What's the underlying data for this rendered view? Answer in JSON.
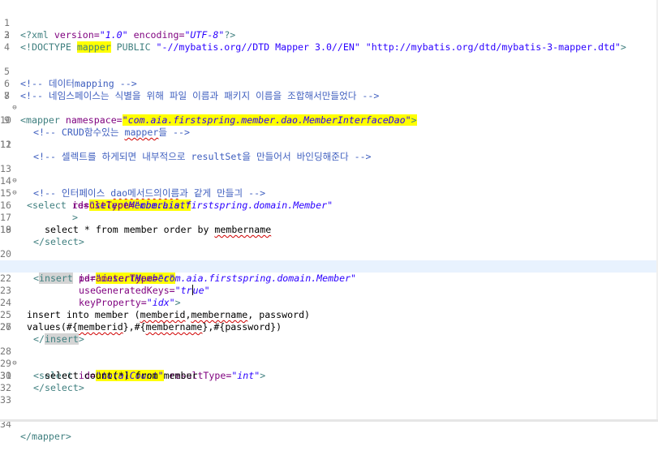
{
  "editor": {
    "lines": {
      "l1": {
        "n": "1",
        "a": "<?xml",
        "b": " version=",
        "c": "\"1.0\"",
        "d": " encoding=",
        "e": "\"UTF-8\"",
        "f": "?>"
      },
      "l2": {
        "n": "2",
        "a": "<!DOCTYPE ",
        "b": "mapper",
        "c": " PUBLIC ",
        "d": "\"-//mybatis.org//DTD Mapper 3.0//EN\" \"http://mybatis.org/dtd/mybatis-3-mapper.dtd\"",
        "e": ">"
      },
      "l3": {
        "n": "3"
      },
      "l4": {
        "n": "4"
      },
      "l5": {
        "n": "5",
        "a": "<!-- 데이터mapping -->"
      },
      "l6": {
        "n": "6",
        "a": "<!-- 네임스페이스는 식별을 위해 파일 이름과 패키지 이름을 조합해서만들었다 -->"
      },
      "l7": {
        "n": "7",
        "a": "<mapper",
        "b": " namespace=",
        "c": "\"com.aia.firstspring.member.dao.MemberInterfaceDao\"",
        "d": ">"
      },
      "l8": {
        "n": "8"
      },
      "l9": {
        "n": "9",
        "a": "<!-- CRUD함수있는 ",
        "b": "mapper",
        "c": "들 -->"
      },
      "l10": {
        "n": "10"
      },
      "l11": {
        "n": "11",
        "a": "<!-- 셀렉트를 하게되면 내부적으로 resultSet을 만들어서 바인딩해준다 -->"
      },
      "l12": {
        "n": "12"
      },
      "l13": {
        "n": "13",
        "a": "<!-- 인터페이스 ",
        "b": "dao메서드의이름",
        "c": "과 같게 만들긔 -->"
      },
      "l14": {
        "n": "14",
        "a": "<select",
        "b": " id=",
        "c": "\"selectMemberList\""
      },
      "l15": {
        "n": "15",
        "a": "resultType=",
        "b": "\"com.aia.firstspring.domain.Member\""
      },
      "l16": {
        "n": "16",
        "a": ">"
      },
      "l17": {
        "n": "17",
        "a": "select * from member order by ",
        "b": "membername"
      },
      "l18": {
        "n": "18",
        "a": "</select>"
      },
      "l19": {
        "n": "19"
      },
      "l20": {
        "n": "20",
        "a": "<",
        "b": "insert",
        "c": " id=",
        "d": "\"insertMember\""
      },
      "l21": {
        "n": "21",
        "a": "parameterType=",
        "b": "\"com.aia.firstspring.domain.Member\""
      },
      "l22": {
        "n": "22",
        "a": "useGeneratedKeys=",
        "b": "\"tr",
        "c": "ue\""
      },
      "l23": {
        "n": "23",
        "a": "keyProperty=",
        "b": "\"idx\"",
        "c": ">"
      },
      "l24": {
        "n": "24",
        "a": "insert into member (",
        "b": "memberid",
        "c": ",",
        "d": "membername",
        "e": ", password)"
      },
      "l25": {
        "n": "25",
        "a": "values(#{",
        "b": "memberid",
        "c": "},#{",
        "d": "membername",
        "e": "},#{password})"
      },
      "l26": {
        "n": "26",
        "a": "</",
        "b": "insert",
        "c": ">"
      },
      "l27": {
        "n": "27"
      },
      "l28": {
        "n": "28",
        "a": "<select",
        "b": " id=",
        "c": "\"totalCount\"",
        "d": " resultType=",
        "e": "\"int\"",
        "f": ">"
      },
      "l29": {
        "n": "29",
        "a": "select count(*) from member"
      },
      "l30": {
        "n": "30",
        "a": "</select>"
      },
      "l31": {
        "n": "31"
      },
      "l32": {
        "n": "32"
      },
      "l33": {
        "n": "33"
      },
      "l34": {
        "n": "34",
        "a": "</mapper>"
      }
    },
    "fold_icon": "⊖",
    "colors": {
      "tag": "#3f7f7f",
      "attribute": "#7f007f",
      "value": "#2a00ff",
      "comment": "#3f5fbf",
      "highlight": "#ffff00",
      "current_line": "#e8f2fe"
    }
  }
}
